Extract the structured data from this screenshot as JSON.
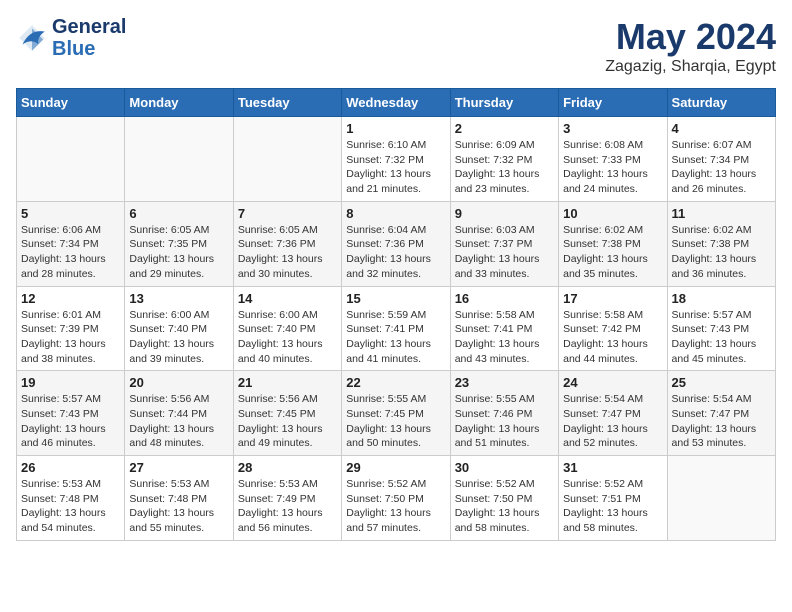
{
  "header": {
    "logo_line1": "General",
    "logo_line2": "Blue",
    "month": "May 2024",
    "location": "Zagazig, Sharqia, Egypt"
  },
  "weekdays": [
    "Sunday",
    "Monday",
    "Tuesday",
    "Wednesday",
    "Thursday",
    "Friday",
    "Saturday"
  ],
  "weeks": [
    [
      {
        "day": "",
        "info": ""
      },
      {
        "day": "",
        "info": ""
      },
      {
        "day": "",
        "info": ""
      },
      {
        "day": "1",
        "info": "Sunrise: 6:10 AM\nSunset: 7:32 PM\nDaylight: 13 hours and 21 minutes."
      },
      {
        "day": "2",
        "info": "Sunrise: 6:09 AM\nSunset: 7:32 PM\nDaylight: 13 hours and 23 minutes."
      },
      {
        "day": "3",
        "info": "Sunrise: 6:08 AM\nSunset: 7:33 PM\nDaylight: 13 hours and 24 minutes."
      },
      {
        "day": "4",
        "info": "Sunrise: 6:07 AM\nSunset: 7:34 PM\nDaylight: 13 hours and 26 minutes."
      }
    ],
    [
      {
        "day": "5",
        "info": "Sunrise: 6:06 AM\nSunset: 7:34 PM\nDaylight: 13 hours and 28 minutes."
      },
      {
        "day": "6",
        "info": "Sunrise: 6:05 AM\nSunset: 7:35 PM\nDaylight: 13 hours and 29 minutes."
      },
      {
        "day": "7",
        "info": "Sunrise: 6:05 AM\nSunset: 7:36 PM\nDaylight: 13 hours and 30 minutes."
      },
      {
        "day": "8",
        "info": "Sunrise: 6:04 AM\nSunset: 7:36 PM\nDaylight: 13 hours and 32 minutes."
      },
      {
        "day": "9",
        "info": "Sunrise: 6:03 AM\nSunset: 7:37 PM\nDaylight: 13 hours and 33 minutes."
      },
      {
        "day": "10",
        "info": "Sunrise: 6:02 AM\nSunset: 7:38 PM\nDaylight: 13 hours and 35 minutes."
      },
      {
        "day": "11",
        "info": "Sunrise: 6:02 AM\nSunset: 7:38 PM\nDaylight: 13 hours and 36 minutes."
      }
    ],
    [
      {
        "day": "12",
        "info": "Sunrise: 6:01 AM\nSunset: 7:39 PM\nDaylight: 13 hours and 38 minutes."
      },
      {
        "day": "13",
        "info": "Sunrise: 6:00 AM\nSunset: 7:40 PM\nDaylight: 13 hours and 39 minutes."
      },
      {
        "day": "14",
        "info": "Sunrise: 6:00 AM\nSunset: 7:40 PM\nDaylight: 13 hours and 40 minutes."
      },
      {
        "day": "15",
        "info": "Sunrise: 5:59 AM\nSunset: 7:41 PM\nDaylight: 13 hours and 41 minutes."
      },
      {
        "day": "16",
        "info": "Sunrise: 5:58 AM\nSunset: 7:41 PM\nDaylight: 13 hours and 43 minutes."
      },
      {
        "day": "17",
        "info": "Sunrise: 5:58 AM\nSunset: 7:42 PM\nDaylight: 13 hours and 44 minutes."
      },
      {
        "day": "18",
        "info": "Sunrise: 5:57 AM\nSunset: 7:43 PM\nDaylight: 13 hours and 45 minutes."
      }
    ],
    [
      {
        "day": "19",
        "info": "Sunrise: 5:57 AM\nSunset: 7:43 PM\nDaylight: 13 hours and 46 minutes."
      },
      {
        "day": "20",
        "info": "Sunrise: 5:56 AM\nSunset: 7:44 PM\nDaylight: 13 hours and 48 minutes."
      },
      {
        "day": "21",
        "info": "Sunrise: 5:56 AM\nSunset: 7:45 PM\nDaylight: 13 hours and 49 minutes."
      },
      {
        "day": "22",
        "info": "Sunrise: 5:55 AM\nSunset: 7:45 PM\nDaylight: 13 hours and 50 minutes."
      },
      {
        "day": "23",
        "info": "Sunrise: 5:55 AM\nSunset: 7:46 PM\nDaylight: 13 hours and 51 minutes."
      },
      {
        "day": "24",
        "info": "Sunrise: 5:54 AM\nSunset: 7:47 PM\nDaylight: 13 hours and 52 minutes."
      },
      {
        "day": "25",
        "info": "Sunrise: 5:54 AM\nSunset: 7:47 PM\nDaylight: 13 hours and 53 minutes."
      }
    ],
    [
      {
        "day": "26",
        "info": "Sunrise: 5:53 AM\nSunset: 7:48 PM\nDaylight: 13 hours and 54 minutes."
      },
      {
        "day": "27",
        "info": "Sunrise: 5:53 AM\nSunset: 7:48 PM\nDaylight: 13 hours and 55 minutes."
      },
      {
        "day": "28",
        "info": "Sunrise: 5:53 AM\nSunset: 7:49 PM\nDaylight: 13 hours and 56 minutes."
      },
      {
        "day": "29",
        "info": "Sunrise: 5:52 AM\nSunset: 7:50 PM\nDaylight: 13 hours and 57 minutes."
      },
      {
        "day": "30",
        "info": "Sunrise: 5:52 AM\nSunset: 7:50 PM\nDaylight: 13 hours and 58 minutes."
      },
      {
        "day": "31",
        "info": "Sunrise: 5:52 AM\nSunset: 7:51 PM\nDaylight: 13 hours and 58 minutes."
      },
      {
        "day": "",
        "info": ""
      }
    ]
  ]
}
